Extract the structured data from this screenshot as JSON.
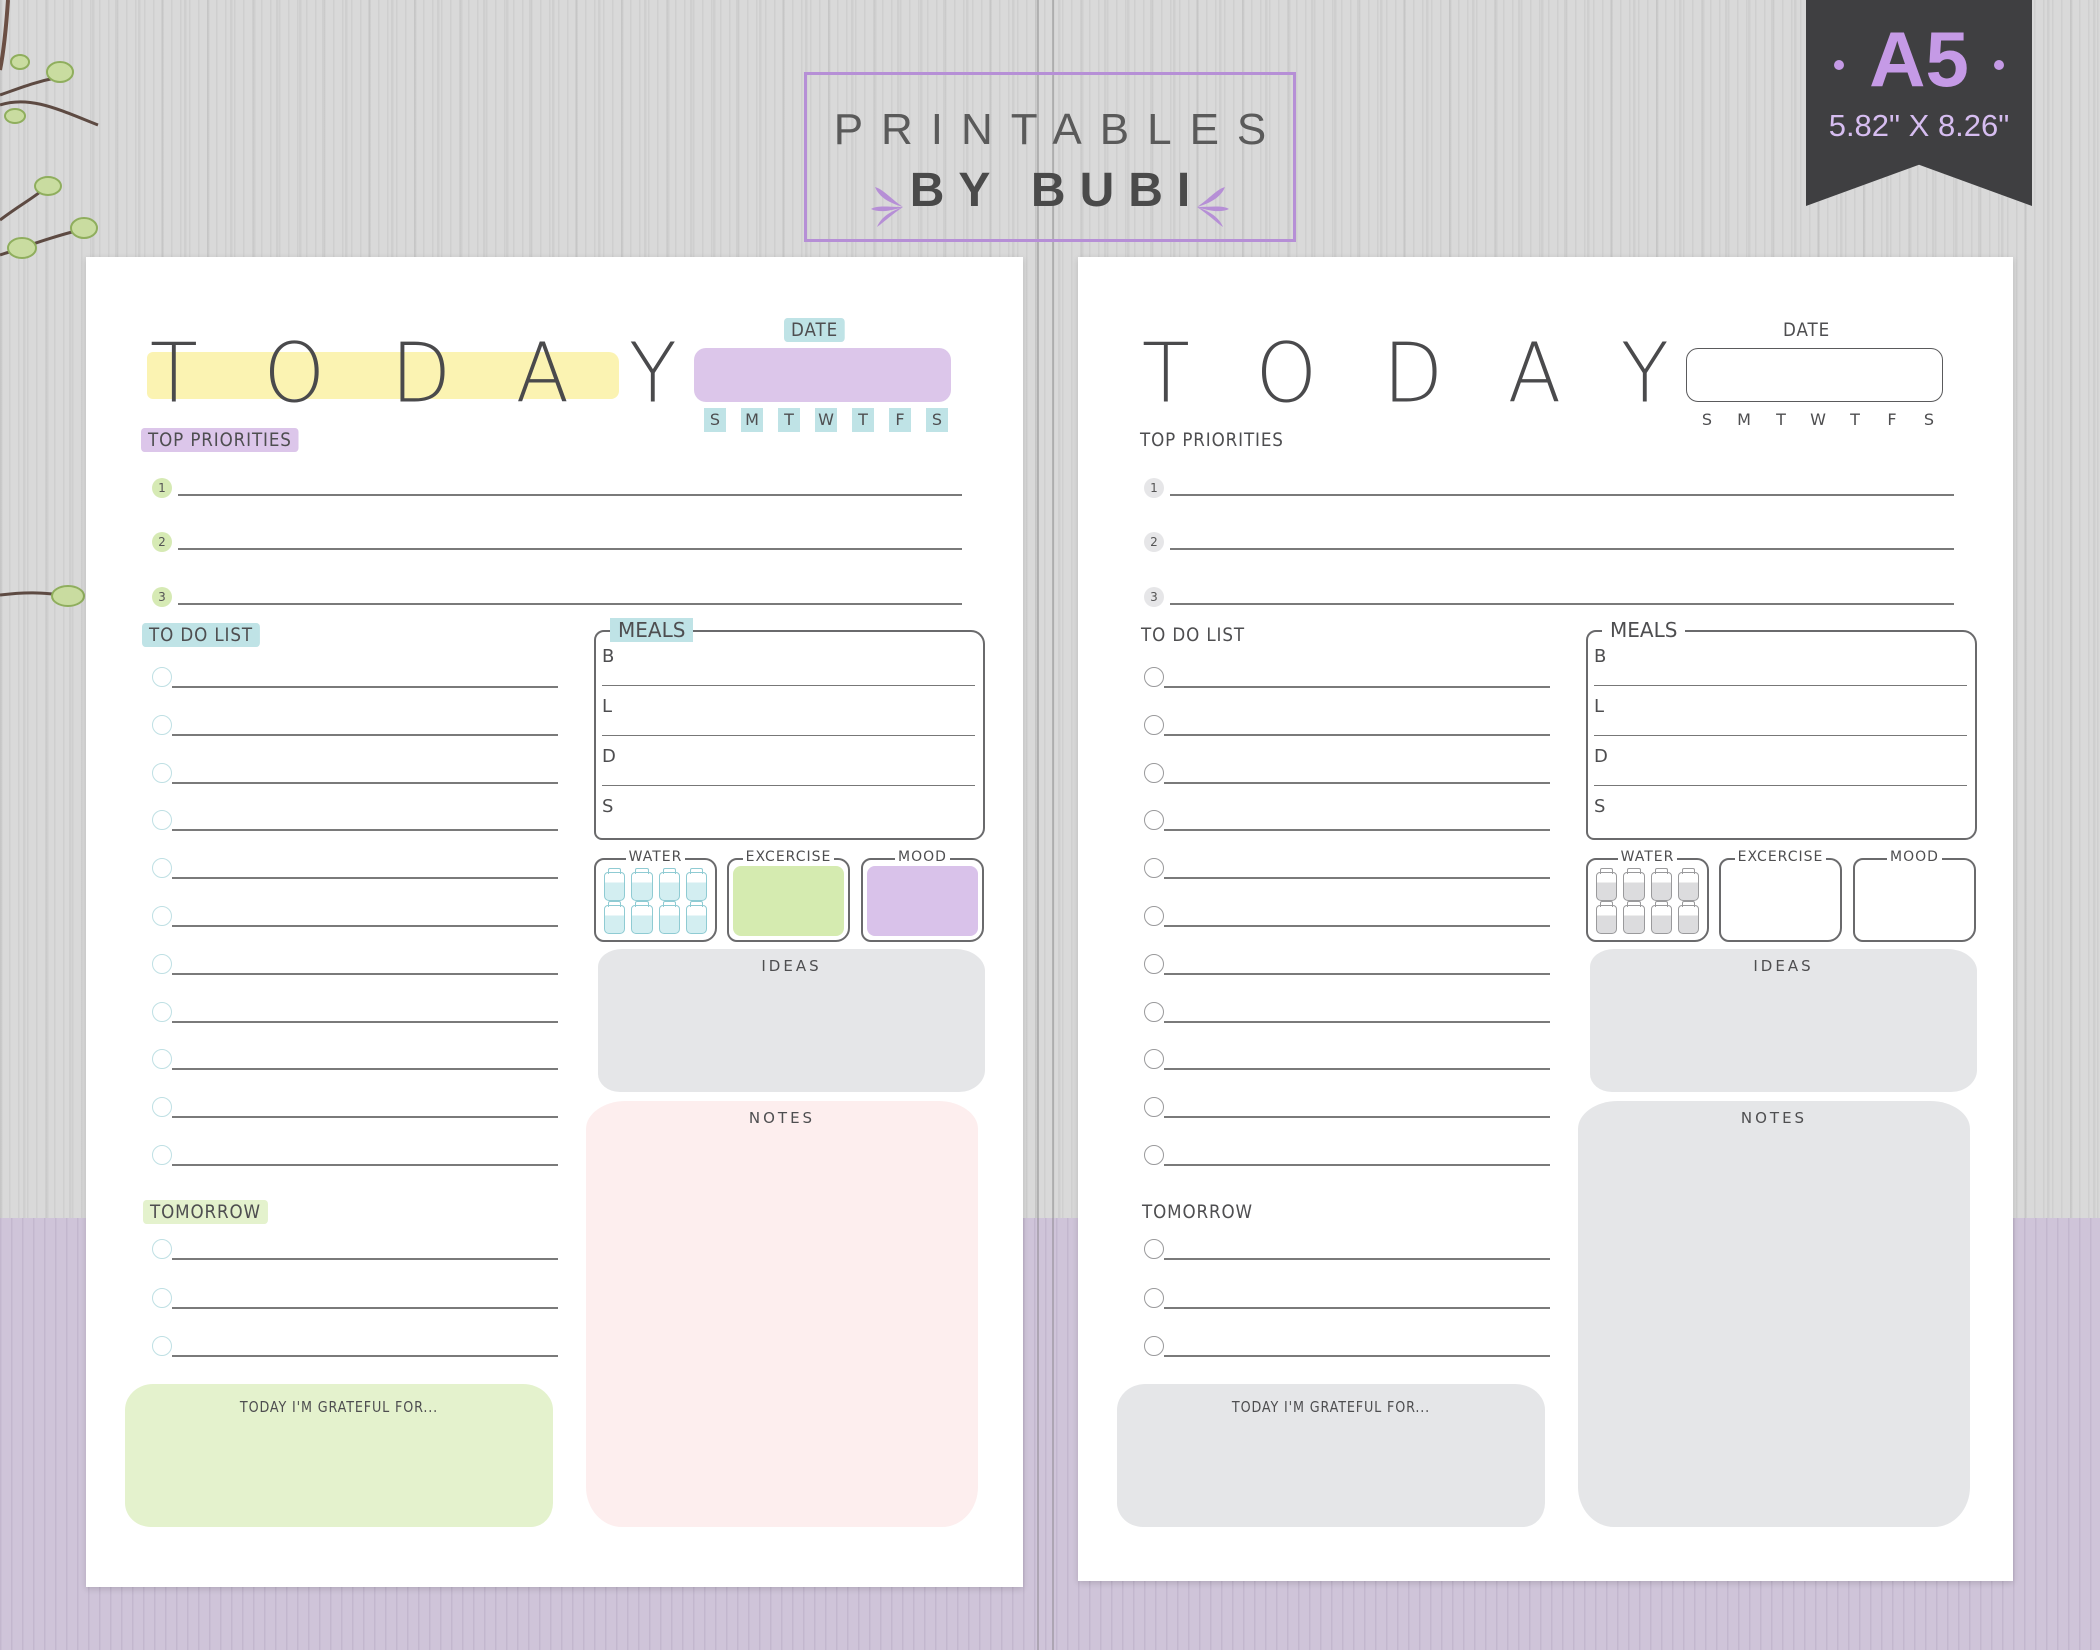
{
  "brand": {
    "line1": "PRINTABLES",
    "line2": "BY BUBI",
    "accent_color": "#b68fd6"
  },
  "size_badge": {
    "size": "A5",
    "dimensions": "5.82\" X 8.26\""
  },
  "colors": {
    "highlight_yellow": "#fbf3b2",
    "lavender": "#dcc6ea",
    "teal": "#bfe3e6",
    "green": "#e4f2cd",
    "pink": "#fdeeee",
    "gray": "#e5e6e8",
    "ink": "#4e4e50"
  },
  "pages": [
    {
      "variant": "color",
      "title": "TODAY",
      "date_label": "DATE",
      "weekdays": [
        "S",
        "M",
        "T",
        "W",
        "T",
        "F",
        "S"
      ],
      "top_priorities": {
        "label": "TOP PRIORITIES",
        "items": [
          "1",
          "2",
          "3"
        ]
      },
      "todo": {
        "label": "TO DO LIST",
        "count": 11
      },
      "meals": {
        "label": "MEALS",
        "rows": [
          "B",
          "L",
          "D",
          "S"
        ]
      },
      "trackers": {
        "water": "WATER",
        "water_glasses": 8,
        "exercise": "EXCERCISE",
        "mood": "MOOD"
      },
      "ideas_label": "IDEAS",
      "notes_label": "NOTES",
      "tomorrow": {
        "label": "TOMORROW",
        "count": 3
      },
      "grateful_label": "TODAY I'M GRATEFUL FOR..."
    },
    {
      "variant": "minimal",
      "title": "TODAY",
      "date_label": "DATE",
      "weekdays": [
        "S",
        "M",
        "T",
        "W",
        "T",
        "F",
        "S"
      ],
      "top_priorities": {
        "label": "TOP PRIORITIES",
        "items": [
          "1",
          "2",
          "3"
        ]
      },
      "todo": {
        "label": "TO DO LIST",
        "count": 11
      },
      "meals": {
        "label": "MEALS",
        "rows": [
          "B",
          "L",
          "D",
          "S"
        ]
      },
      "trackers": {
        "water": "WATER",
        "water_glasses": 8,
        "exercise": "EXCERCISE",
        "mood": "MOOD"
      },
      "ideas_label": "IDEAS",
      "notes_label": "NOTES",
      "tomorrow": {
        "label": "TOMORROW",
        "count": 3
      },
      "grateful_label": "TODAY I'M GRATEFUL FOR..."
    }
  ]
}
